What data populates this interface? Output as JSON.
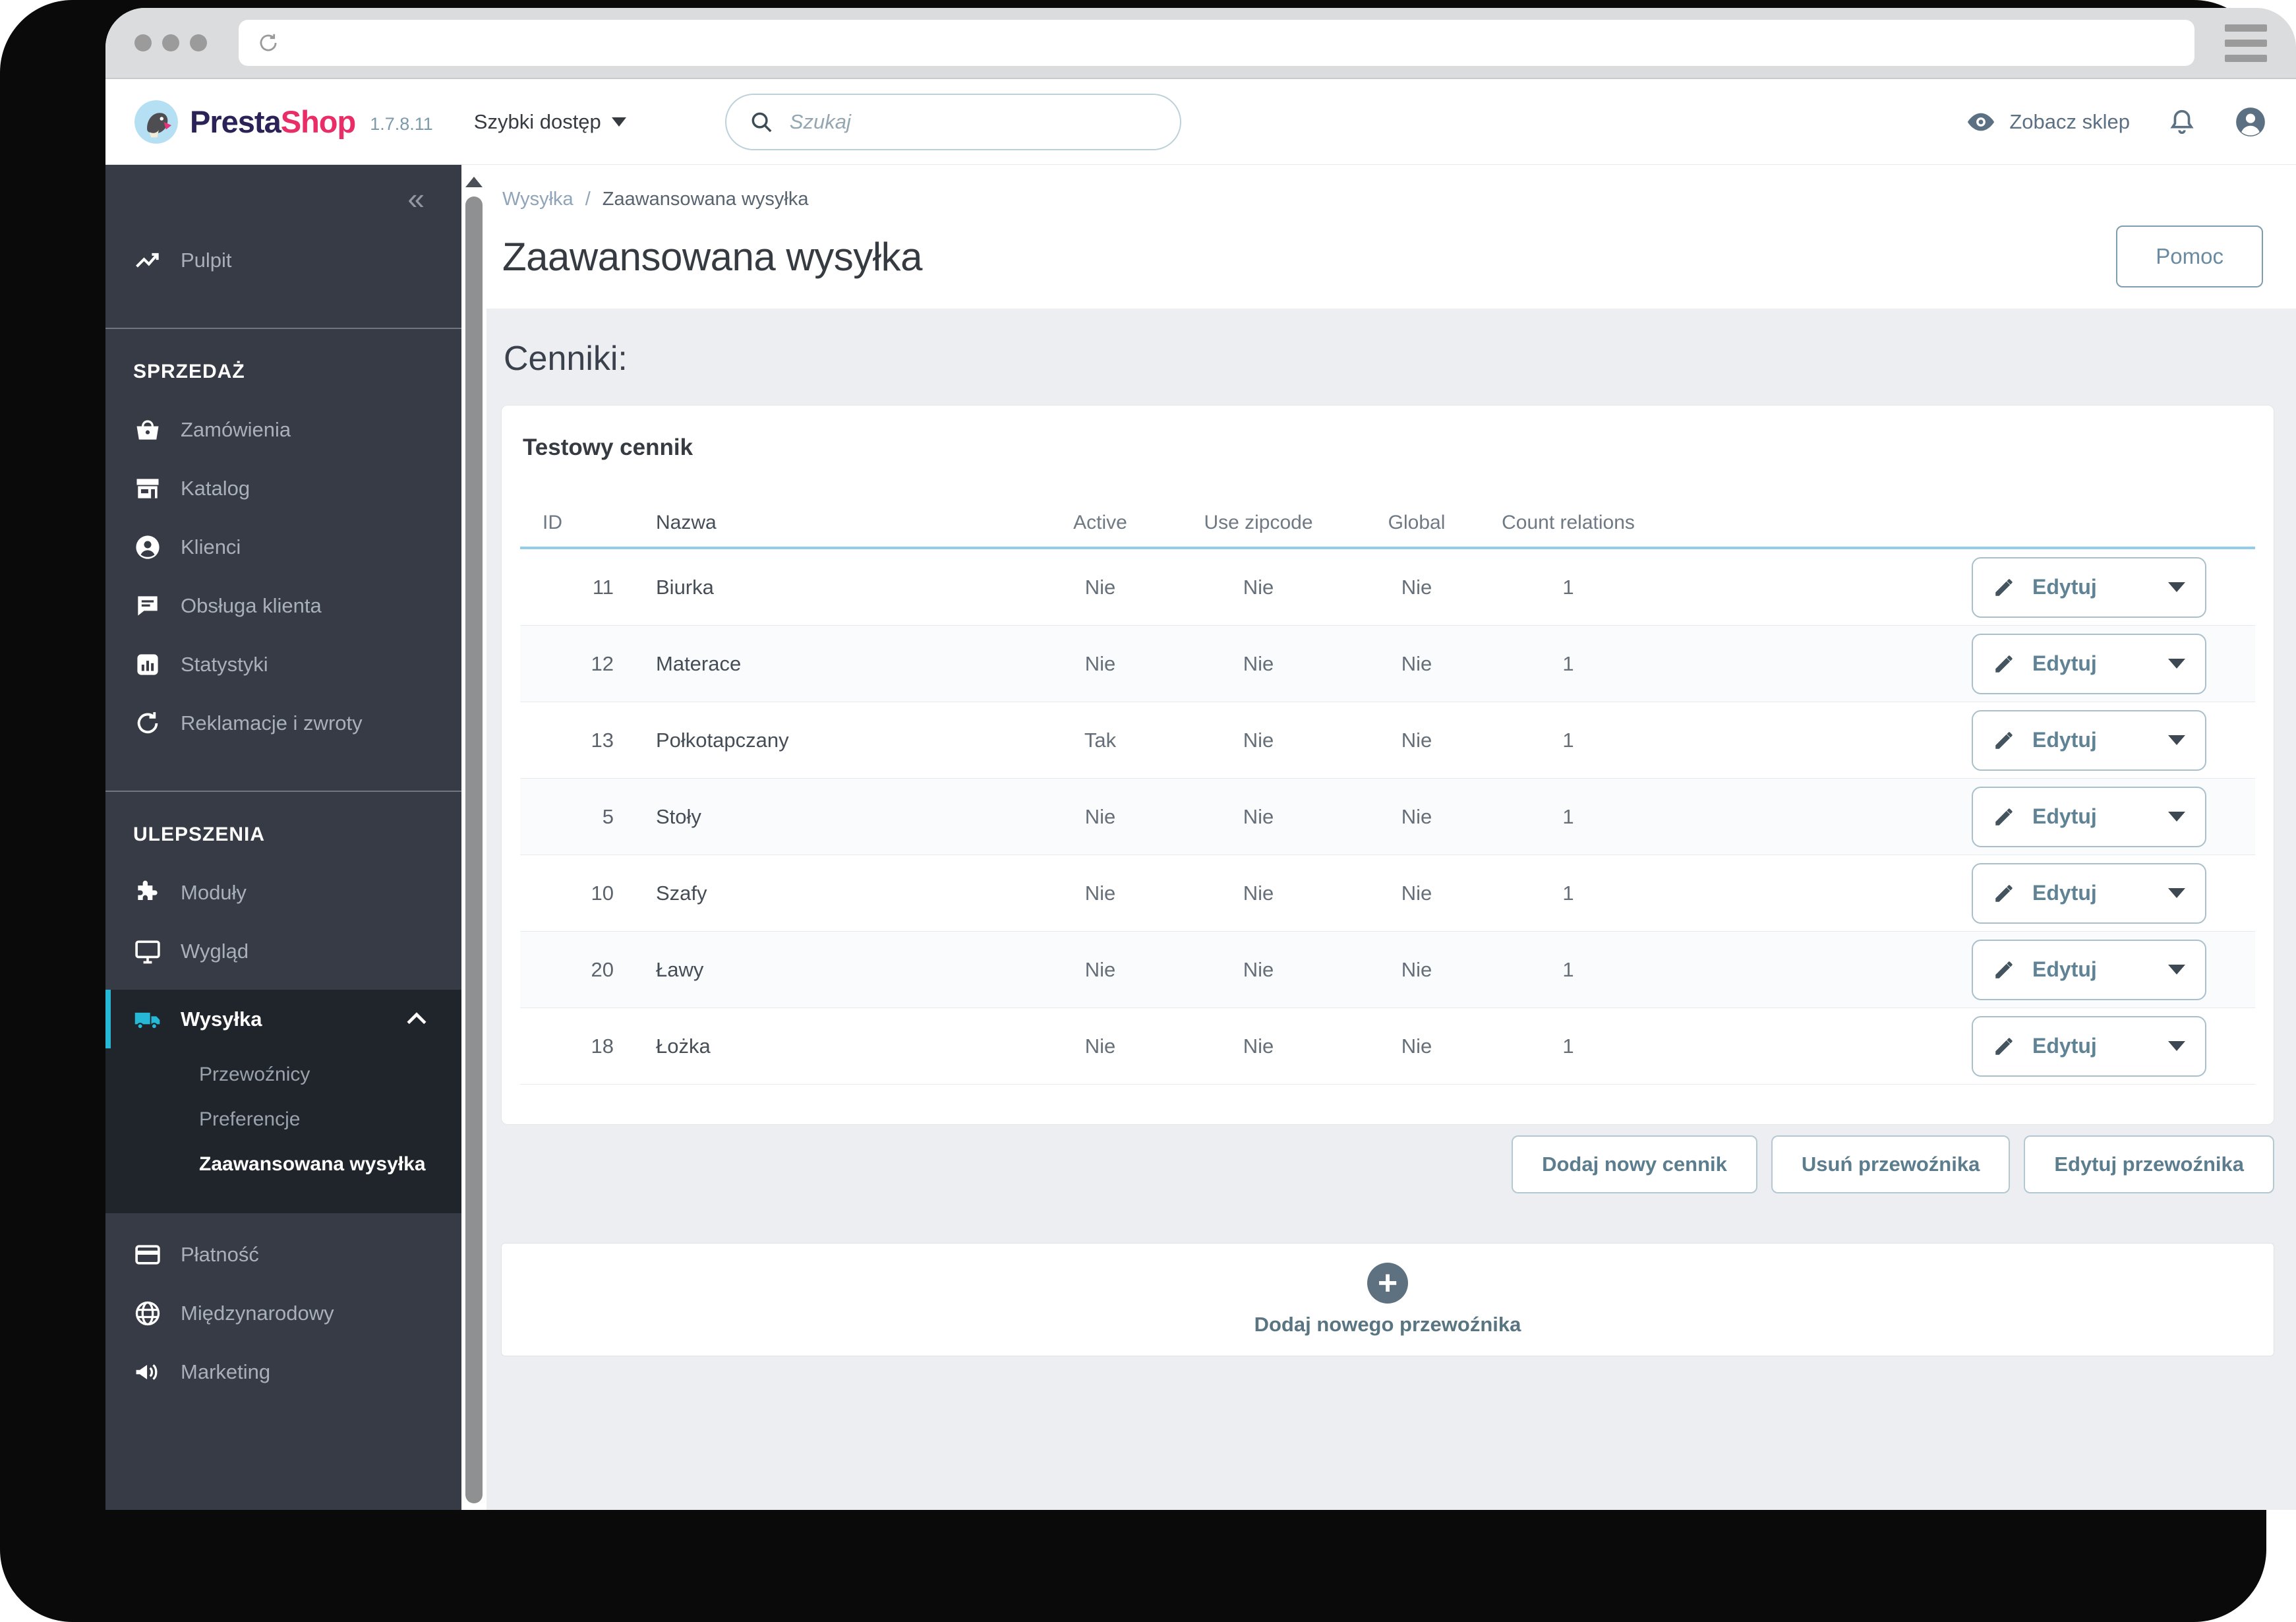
{
  "colors": {
    "accent": "#25b9d7",
    "logo_presta": "#2b2358",
    "logo_shop": "#e92d66",
    "sidebar_bg": "#363b45",
    "sidebar_active_bg": "#20242b",
    "table_header_underline": "#93cdec",
    "slate_text": "#5b7082"
  },
  "icons": [
    "refresh-icon",
    "hamburger-menu-icon",
    "prestashop-bird-logo",
    "chevron-down-icon",
    "search-icon",
    "eye-icon",
    "bell-icon",
    "avatar-icon",
    "collapse-sidebar-icon",
    "trend-up-icon",
    "basket-icon",
    "store-icon",
    "person-icon",
    "chat-icon",
    "bar-chart-icon",
    "returns-icon",
    "puzzle-icon",
    "monitor-icon",
    "truck-icon",
    "chevron-up-icon",
    "credit-card-icon",
    "globe-icon",
    "megaphone-icon",
    "pencil-icon",
    "plus-icon"
  ],
  "header": {
    "logo_presta": "Presta",
    "logo_shop": "Shop",
    "version": "1.7.8.11",
    "quick_access": "Szybki dostęp",
    "search_placeholder": "Szukaj",
    "view_shop": "Zobacz sklep"
  },
  "sidebar": {
    "collapse": "«",
    "pulpit": "Pulpit",
    "sales_title": "SPRZEDAŻ",
    "sales_items": [
      "Zamówienia",
      "Katalog",
      "Klienci",
      "Obsługa klienta",
      "Statystyki",
      "Reklamacje i zwroty"
    ],
    "improve_title": "ULEPSZENIA",
    "moduly": "Moduły",
    "wyglad": "Wygląd",
    "wysylka": "Wysyłka",
    "shipping_submenu": [
      "Przewoźnicy",
      "Preferencje",
      "Zaawansowana wysyłka"
    ],
    "other_items": [
      "Płatność",
      "Międzynarodowy",
      "Marketing"
    ]
  },
  "breadcrumb": {
    "parent": "Wysyłka",
    "separator": "/",
    "current": "Zaawansowana wysyłka"
  },
  "page": {
    "title": "Zaawansowana wysyłka",
    "help_button": "Pomoc",
    "section_heading": "Cenniki:"
  },
  "panel": {
    "title": "Testowy cennik",
    "columns": [
      "ID",
      "Nazwa",
      "Active",
      "Use zipcode",
      "Global",
      "Count relations"
    ],
    "edit_label": "Edytuj",
    "rows": [
      {
        "id": "11",
        "name": "Biurka",
        "active": "Nie",
        "zipcode": "Nie",
        "global": "Nie",
        "count": "1"
      },
      {
        "id": "12",
        "name": "Materace",
        "active": "Nie",
        "zipcode": "Nie",
        "global": "Nie",
        "count": "1"
      },
      {
        "id": "13",
        "name": "Połkotapczany",
        "active": "Tak",
        "zipcode": "Nie",
        "global": "Nie",
        "count": "1"
      },
      {
        "id": "5",
        "name": "Stoły",
        "active": "Nie",
        "zipcode": "Nie",
        "global": "Nie",
        "count": "1"
      },
      {
        "id": "10",
        "name": "Szafy",
        "active": "Nie",
        "zipcode": "Nie",
        "global": "Nie",
        "count": "1"
      },
      {
        "id": "20",
        "name": "Ławy",
        "active": "Nie",
        "zipcode": "Nie",
        "global": "Nie",
        "count": "1"
      },
      {
        "id": "18",
        "name": "Łożka",
        "active": "Nie",
        "zipcode": "Nie",
        "global": "Nie",
        "count": "1"
      }
    ]
  },
  "actions": {
    "add_pricelist": "Dodaj nowy cennik",
    "delete_carrier": "Usuń przewoźnika",
    "edit_carrier": "Edytuj przewoźnika"
  },
  "footer_action": {
    "label": "Dodaj nowego przewoźnika"
  }
}
